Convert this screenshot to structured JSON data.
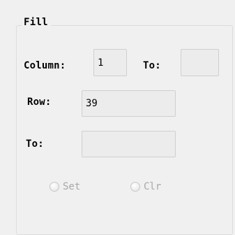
{
  "fill_group": {
    "title": "Fill",
    "column_label": "Column:",
    "column_value": "1",
    "column_to_label": "To:",
    "column_to_value": "",
    "row_label": "Row:",
    "row_value": "39",
    "row_to_label": "To:",
    "row_to_value": "",
    "set_label": "Set",
    "clr_label": "Clr"
  }
}
